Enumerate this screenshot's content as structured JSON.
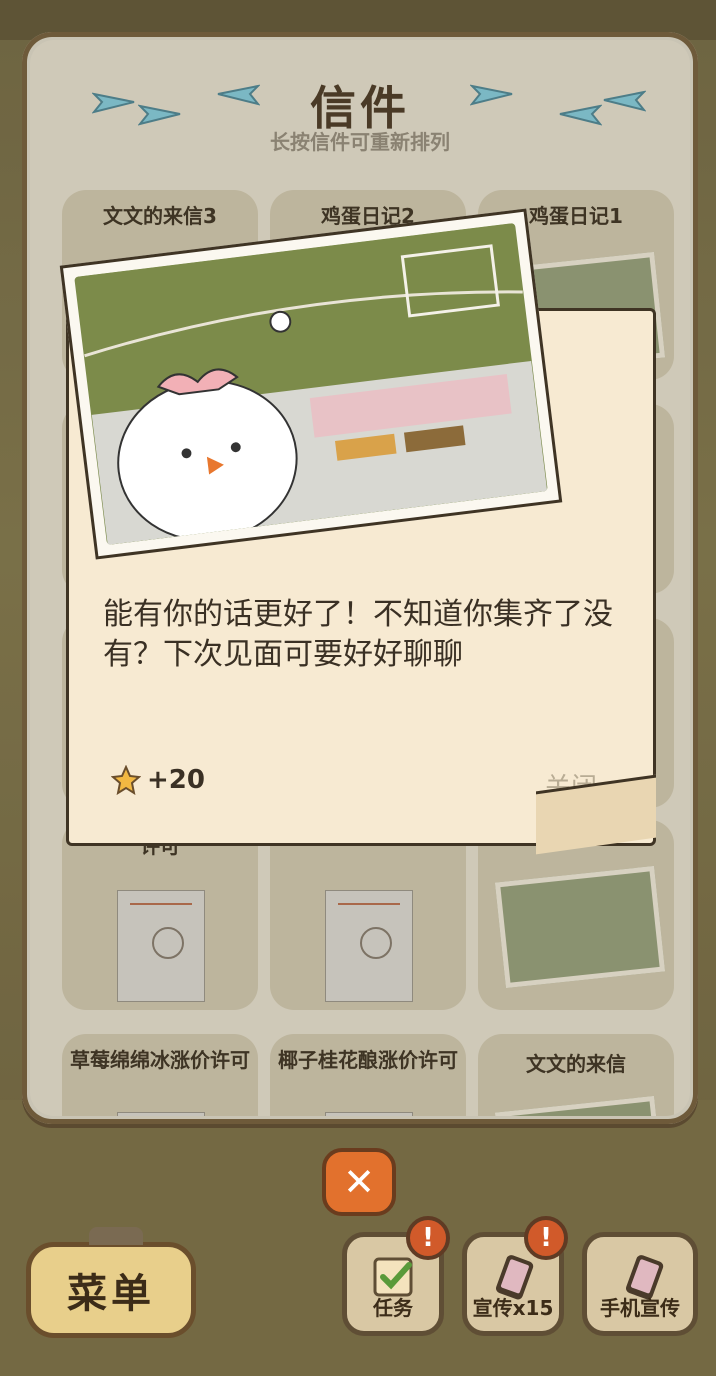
{
  "panel": {
    "title": "信件",
    "subtitle": "长按信件可重新排列",
    "cards": [
      {
        "title": "文文的来信3",
        "thumb": "photo"
      },
      {
        "title": "鸡蛋日记2",
        "thumb": "photo"
      },
      {
        "title": "鸡蛋日记1",
        "thumb": "photo"
      },
      {
        "title": "许可",
        "thumb": "doc"
      },
      {
        "title": "",
        "thumb": "doc"
      },
      {
        "title": "",
        "thumb": "photo"
      },
      {
        "title": "草莓绵绵冰涨价许可",
        "thumb": "doc"
      },
      {
        "title": "椰子桂花酿涨价许可",
        "thumb": "doc"
      },
      {
        "title": "文文的来信",
        "thumb": "photo"
      }
    ]
  },
  "letter": {
    "text": "能有你的话更好了！不知道你集齐了没有？下次见面可要好好聊聊",
    "reward": "+20",
    "close": "关闭"
  },
  "bottom": {
    "menu": "菜单",
    "tasks": "任务",
    "promote": "宣传x15",
    "phone_promote": "手机宣传",
    "alert_mark": "!"
  },
  "colors": {
    "accent": "#e2712d",
    "paper": "#f7ead2",
    "outline": "#3f3424"
  }
}
